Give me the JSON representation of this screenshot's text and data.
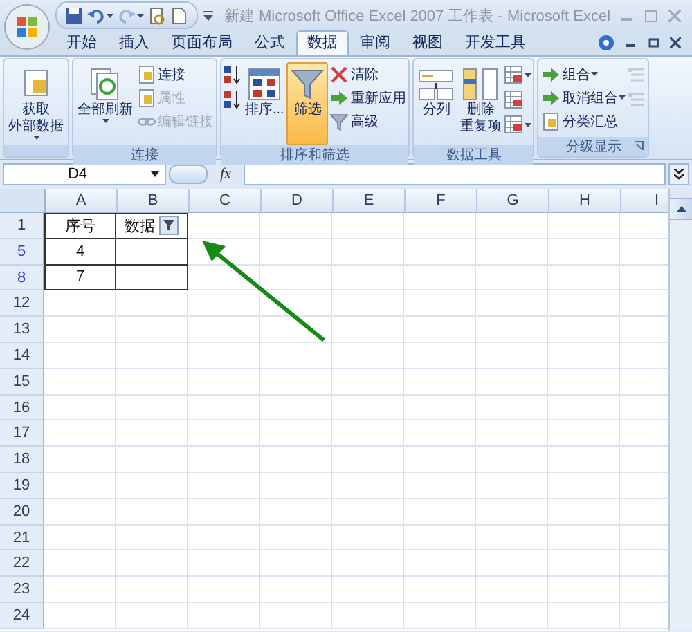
{
  "window": {
    "title": "新建 Microsoft Office Excel 2007 工作表 - Microsoft Excel"
  },
  "quick_access": [
    {
      "kind": "save",
      "disabled": false,
      "caret": false
    },
    {
      "kind": "undo",
      "disabled": false,
      "caret": true
    },
    {
      "kind": "redo",
      "disabled": true,
      "caret": true
    },
    {
      "kind": "preview",
      "disabled": false,
      "caret": false
    },
    {
      "kind": "new",
      "disabled": false,
      "caret": false
    }
  ],
  "tabs": [
    {
      "label": "开始",
      "selected": false
    },
    {
      "label": "插入",
      "selected": false
    },
    {
      "label": "页面布局",
      "selected": false
    },
    {
      "label": "公式",
      "selected": false
    },
    {
      "label": "数据",
      "selected": true
    },
    {
      "label": "审阅",
      "selected": false
    },
    {
      "label": "视图",
      "selected": false
    },
    {
      "label": "开发工具",
      "selected": false
    }
  ],
  "ribbon": {
    "groups": [
      {
        "launcher": false,
        "items": [
          {
            "kind": "large",
            "lines": [
              "获取",
              "外部数据"
            ],
            "caret": true,
            "selected": false
          }
        ]
      },
      {
        "label": "连接",
        "launcher": false,
        "items": [
          {
            "kind": "large",
            "lines": [
              "全部刷新"
            ],
            "caret": true,
            "selected": false
          },
          {
            "kind": "small",
            "label": "连接",
            "caret": false,
            "disabled": false
          },
          {
            "kind": "small",
            "label": "属性",
            "caret": false,
            "disabled": true
          },
          {
            "kind": "small",
            "label": "编辑链接",
            "caret": false,
            "disabled": true
          }
        ]
      },
      {
        "label": "排序和筛选",
        "launcher": false,
        "items": [
          {
            "kind": "icon",
            "caret": false,
            "disabled": false
          },
          {
            "kind": "icon",
            "caret": false,
            "disabled": false
          },
          {
            "kind": "large",
            "lines": [
              "排序..."
            ],
            "caret": false,
            "selected": false
          },
          {
            "kind": "large",
            "lines": [
              "筛选"
            ],
            "caret": false,
            "selected": true
          },
          {
            "kind": "small",
            "label": "清除",
            "caret": false,
            "disabled": false
          },
          {
            "kind": "small",
            "label": "重新应用",
            "caret": false,
            "disabled": false
          },
          {
            "kind": "small",
            "label": "高级",
            "caret": false,
            "disabled": false
          }
        ]
      },
      {
        "label": "数据工具",
        "launcher": false,
        "items": [
          {
            "kind": "large",
            "lines": [
              "分列"
            ],
            "caret": false,
            "selected": false
          },
          {
            "kind": "large",
            "lines": [
              "删除",
              "重复项"
            ],
            "caret": false,
            "selected": false
          },
          {
            "kind": "icon",
            "caret": true,
            "disabled": false
          },
          {
            "kind": "icon",
            "caret": false,
            "disabled": false
          },
          {
            "kind": "icon",
            "caret": true,
            "disabled": false
          }
        ]
      },
      {
        "label": "分级显示",
        "launcher": true,
        "items": [
          {
            "kind": "small",
            "label": "组合",
            "caret": true,
            "disabled": false
          },
          {
            "kind": "small",
            "label": "取消组合",
            "caret": true,
            "disabled": false
          },
          {
            "kind": "small",
            "label": "分类汇总",
            "caret": false,
            "disabled": false
          },
          {
            "kind": "icon",
            "caret": false,
            "disabled": true
          },
          {
            "kind": "icon",
            "caret": false,
            "disabled": true
          }
        ]
      }
    ]
  },
  "formula_bar": {
    "name_box": "D4",
    "function_label": "fx"
  },
  "grid": {
    "columns": [
      "A",
      "B",
      "C",
      "D",
      "E",
      "F",
      "G",
      "H",
      "I"
    ],
    "rows": [
      {
        "header": "1",
        "filtered": false,
        "bordered": true,
        "cells": [
          {
            "text": "序号",
            "filter_button": false
          },
          {
            "text": "数据",
            "filter_button": true
          }
        ]
      },
      {
        "header": "5",
        "filtered": true,
        "bordered": true,
        "cells": [
          {
            "text": "4",
            "filter_button": false
          }
        ]
      },
      {
        "header": "8",
        "filtered": true,
        "bordered": true,
        "cells": [
          {
            "text": "7",
            "filter_button": false
          }
        ]
      },
      {
        "header": "12",
        "filtered": false,
        "bordered": false,
        "cells": []
      },
      {
        "header": "13",
        "filtered": false,
        "bordered": false,
        "cells": []
      },
      {
        "header": "14",
        "filtered": false,
        "bordered": false,
        "cells": []
      },
      {
        "header": "15",
        "filtered": false,
        "bordered": false,
        "cells": []
      },
      {
        "header": "16",
        "filtered": false,
        "bordered": false,
        "cells": []
      },
      {
        "header": "17",
        "filtered": false,
        "bordered": false,
        "cells": []
      },
      {
        "header": "18",
        "filtered": false,
        "bordered": false,
        "cells": []
      },
      {
        "header": "19",
        "filtered": false,
        "bordered": false,
        "cells": []
      },
      {
        "header": "20",
        "filtered": false,
        "bordered": false,
        "cells": []
      },
      {
        "header": "21",
        "filtered": false,
        "bordered": false,
        "cells": []
      },
      {
        "header": "22",
        "filtered": false,
        "bordered": false,
        "cells": []
      },
      {
        "header": "23",
        "filtered": false,
        "bordered": false,
        "cells": []
      },
      {
        "header": "24",
        "filtered": false,
        "bordered": false,
        "cells": []
      }
    ]
  }
}
